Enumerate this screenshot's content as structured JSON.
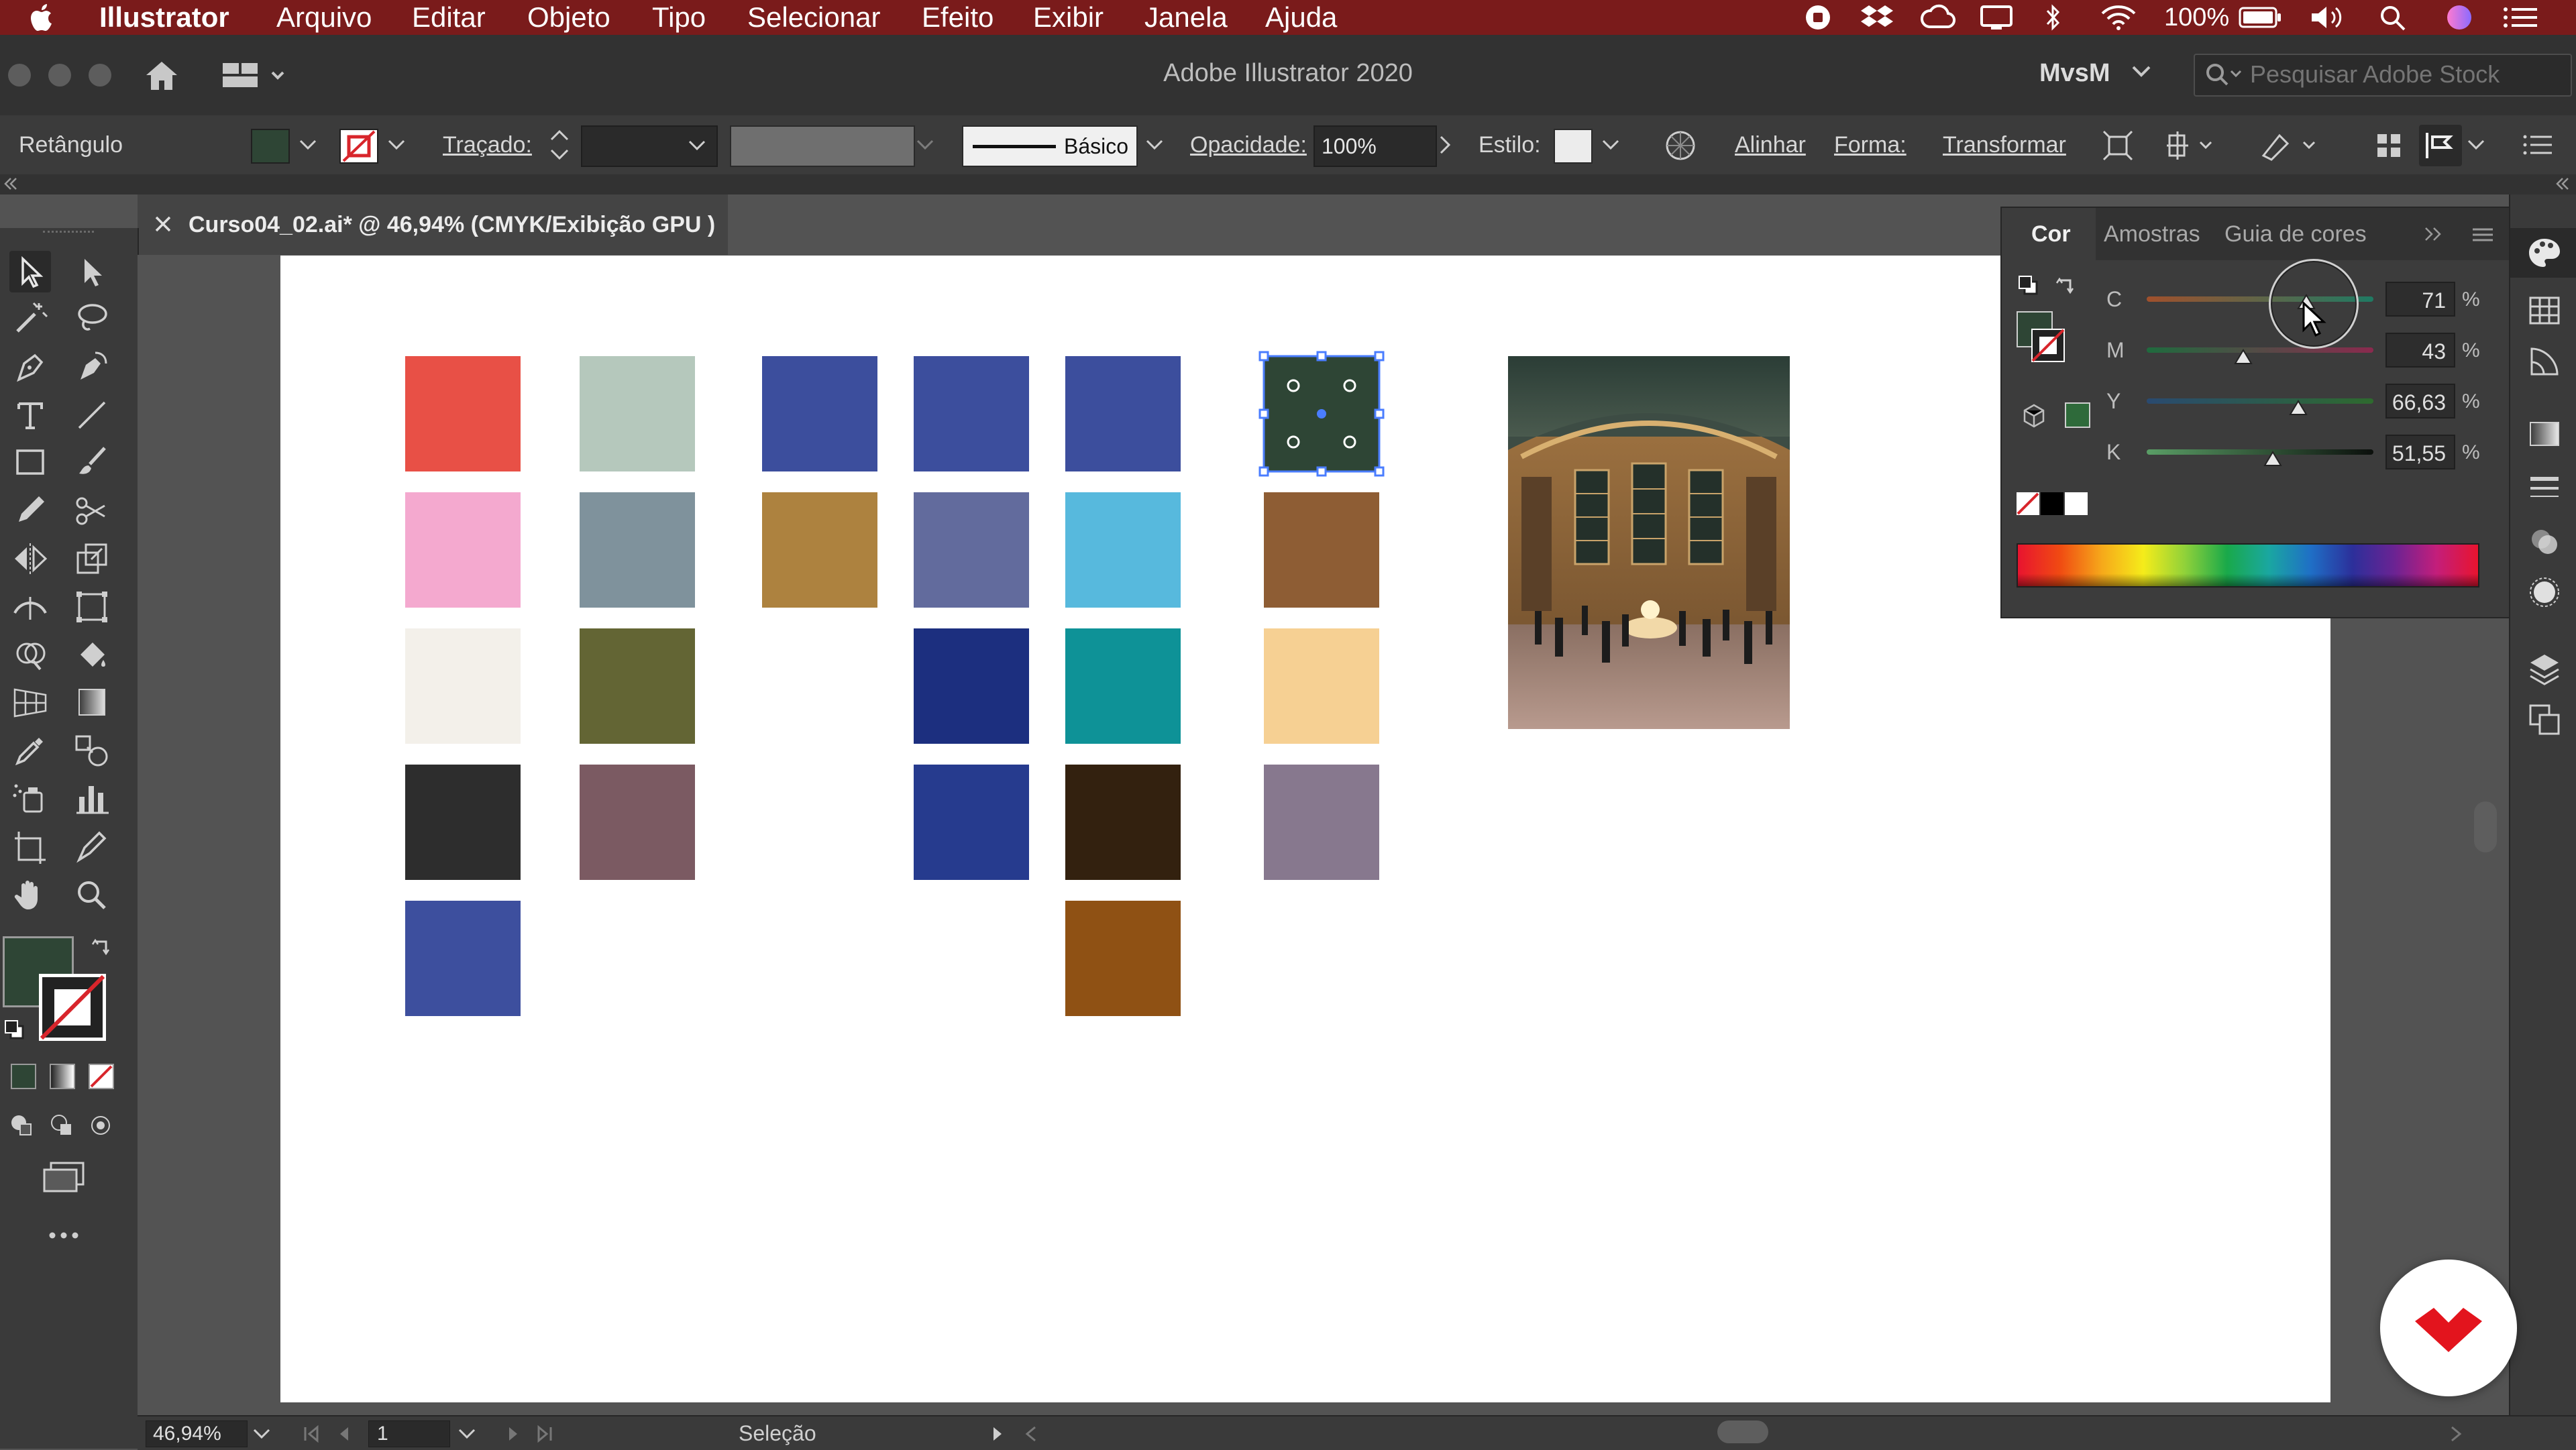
{
  "menubar": {
    "app_name": "Illustrator",
    "items": [
      "Arquivo",
      "Editar",
      "Objeto",
      "Tipo",
      "Selecionar",
      "Efeito",
      "Exibir",
      "Janela",
      "Ajuda"
    ],
    "battery": "100%"
  },
  "titlebar": {
    "title": "Adobe Illustrator 2020",
    "workspace": "MvsM",
    "stock_search_placeholder": "Pesquisar Adobe Stock"
  },
  "controlbar": {
    "selection_type": "Retângulo",
    "fill_color": "#2e4535",
    "stroke_label": "Traçado:",
    "brush_label": "Básico",
    "opacity_label": "Opacidade:",
    "opacity_value": "100%",
    "style_label": "Estilo:",
    "align_label": "Alinhar",
    "shape_label": "Forma:",
    "transform_label": "Transformar"
  },
  "document": {
    "tab_label": "Curso04_02.ai* @ 46,94% (CMYK/Exibição GPU )"
  },
  "artboard": {
    "swatches": [
      {
        "color": "#e85046"
      },
      {
        "color": "#f4a9cf"
      },
      {
        "color": "#f3f0ea"
      },
      {
        "color": "#2d2d2d"
      },
      {
        "color": "#3d4f9e"
      },
      {
        "color": "#b5c8bc"
      },
      {
        "color": "#7f929c"
      },
      {
        "color": "#636534"
      },
      {
        "color": "#7b5a62"
      },
      {
        "color": "#3c4e9d"
      },
      {
        "color": "#ad823f"
      },
      {
        "color": "#3c4e9d"
      },
      {
        "color": "#626b9d"
      },
      {
        "color": "#1c2f7f"
      },
      {
        "color": "#263b8e"
      },
      {
        "color": "#3c4e9d"
      },
      {
        "color": "#57b9dd"
      },
      {
        "color": "#0e9297"
      },
      {
        "color": "#33210f"
      },
      {
        "color": "#8f5114"
      },
      {
        "color": "#2e4535",
        "selected": true
      },
      {
        "color": "#8e5d34"
      },
      {
        "color": "#f6d093"
      },
      {
        "color": "#87788e"
      }
    ]
  },
  "color_panel": {
    "tabs": [
      "Cor",
      "Amostras",
      "Guia de cores"
    ],
    "channels": [
      {
        "label": "C",
        "value": "71",
        "pct": "%"
      },
      {
        "label": "M",
        "value": "43",
        "pct": "%"
      },
      {
        "label": "Y",
        "value": "66,63",
        "pct": "%"
      },
      {
        "label": "K",
        "value": "51,55",
        "pct": "%"
      }
    ],
    "current_color": "#2e4535"
  },
  "statusbar": {
    "zoom": "46,94%",
    "artboard_number": "1",
    "tool_name": "Seleção"
  }
}
